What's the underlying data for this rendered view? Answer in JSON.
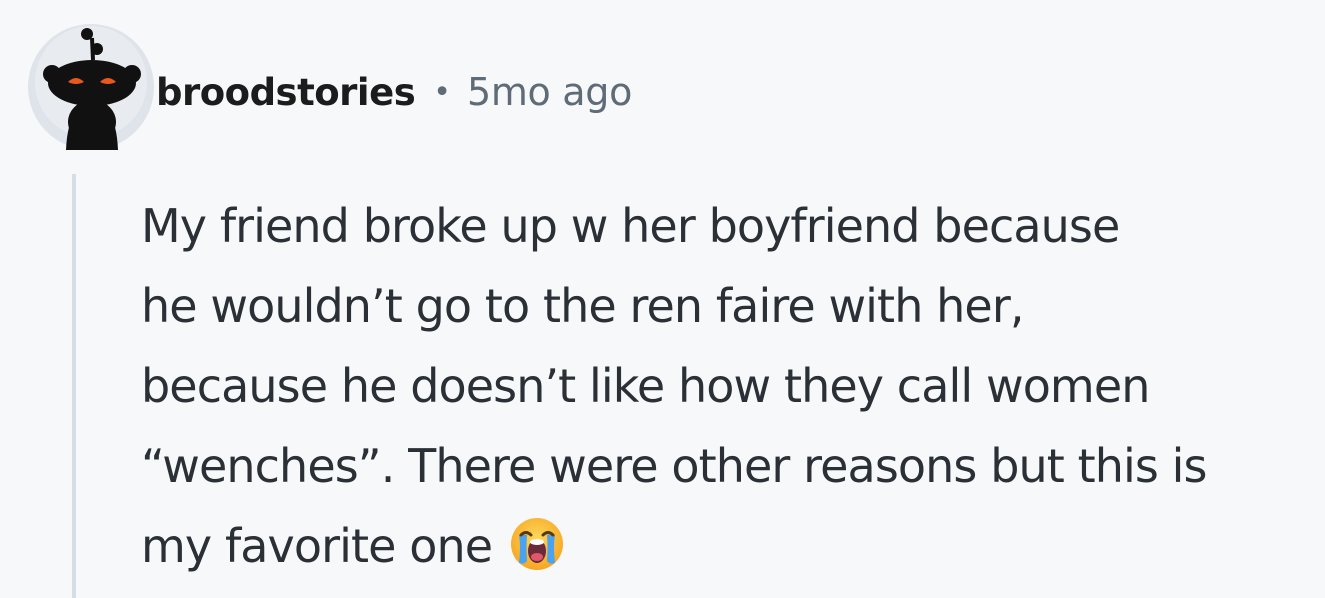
{
  "comment": {
    "username": "broodstories",
    "separator": "•",
    "timestamp": "5mo ago",
    "body_lines": [
      "My friend broke up w her boyfriend because",
      "he wouldn’t go to the ren faire with her,",
      "because he doesn’t like how they call women",
      "“wenches”. There were other reasons but this is",
      "my favorite one"
    ],
    "emoji": "loudly-crying-face"
  },
  "colors": {
    "background": "#f7f8fa",
    "username": "#1c1c1c",
    "meta": "#5f6b76",
    "body_text": "#2a3036",
    "thread_line": "#d5dde5"
  }
}
